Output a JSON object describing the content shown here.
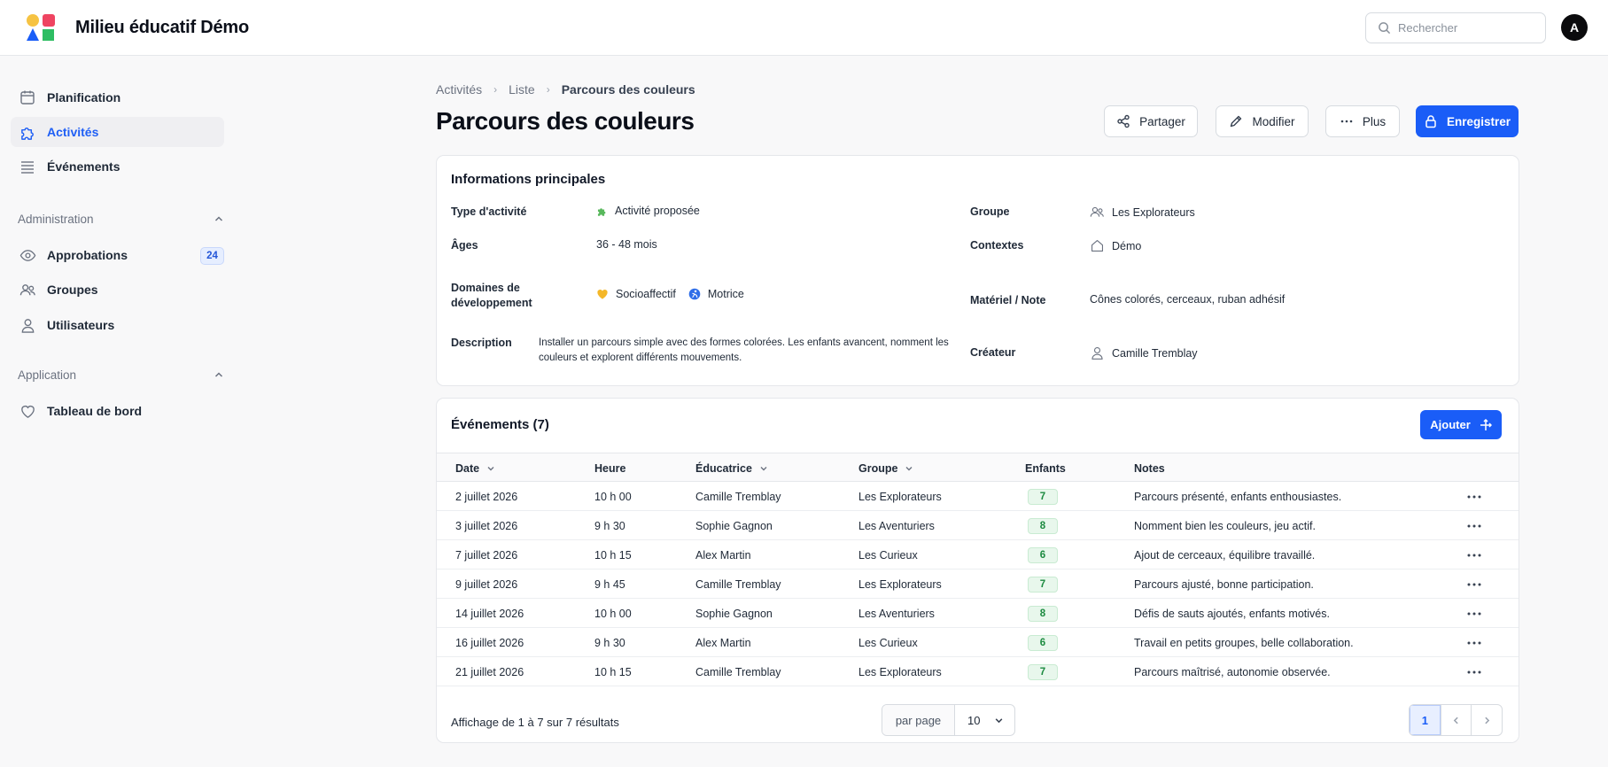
{
  "app": {
    "title": "Milieu éducatif Démo",
    "avatar_initial": "A"
  },
  "search": {
    "placeholder": "Rechercher",
    "value": ""
  },
  "sidebar": {
    "main_items": [
      {
        "label": "Planification",
        "icon": "calendar-icon"
      },
      {
        "label": "Activités",
        "icon": "puzzle-icon",
        "active": true
      },
      {
        "label": "Événements",
        "icon": "list-icon"
      }
    ],
    "administration": {
      "title": "Administration",
      "items": [
        {
          "label": "Approbations",
          "icon": "eye-icon",
          "badge": "24"
        },
        {
          "label": "Groupes",
          "icon": "users-icon"
        },
        {
          "label": "Utilisateurs",
          "icon": "user-icon"
        }
      ]
    },
    "application": {
      "title": "Application",
      "items": [
        {
          "label": "Tableau de bord",
          "icon": "heart-icon"
        }
      ]
    }
  },
  "breadcrumb": {
    "root": "Activités",
    "list": "Liste",
    "current": "Parcours des couleurs"
  },
  "page": {
    "title": "Parcours des couleurs"
  },
  "actions": {
    "share": "Partager",
    "edit": "Modifier",
    "more": "Plus",
    "save": "Enregistrer"
  },
  "info": {
    "title": "Informations principales",
    "type_label": "Type d'activité",
    "type_value": "Activité proposée",
    "ages_label": "Âges",
    "ages_value": "36 - 48 mois",
    "domains_label": "Domaines de développement",
    "domains": [
      "Socioaffectif",
      "Motrice"
    ],
    "description_label": "Description",
    "description": "Installer un parcours simple avec des formes colorées. Les enfants avancent, nomment les couleurs et explorent différents mouvements.",
    "group_label": "Groupe",
    "group_value": "Les Explorateurs",
    "contexts_label": "Contextes",
    "contexts_value": "Démo",
    "material_label": "Matériel / Note",
    "material_value": "Cônes colorés, cerceaux, ruban adhésif",
    "creator_label": "Créateur",
    "creator_value": "Camille Tremblay"
  },
  "events": {
    "title": "Événements (7)",
    "add_label": "Ajouter",
    "columns": {
      "date": "Date",
      "time": "Heure",
      "educator": "Éducatrice",
      "group": "Groupe",
      "kids": "Enfants",
      "notes": "Notes"
    },
    "rows": [
      {
        "date": "2 juillet 2026",
        "time": "10 h 00",
        "educator": "Camille Tremblay",
        "group": "Les Explorateurs",
        "kids": "7",
        "notes": "Parcours présenté, enfants enthousiastes."
      },
      {
        "date": "3 juillet 2026",
        "time": "9 h 30",
        "educator": "Sophie Gagnon",
        "group": "Les Aventuriers",
        "kids": "8",
        "notes": "Nomment bien les couleurs, jeu actif."
      },
      {
        "date": "7 juillet 2026",
        "time": "10 h 15",
        "educator": "Alex Martin",
        "group": "Les Curieux",
        "kids": "6",
        "notes": "Ajout de cerceaux, équilibre travaillé."
      },
      {
        "date": "9 juillet 2026",
        "time": "9 h 45",
        "educator": "Camille Tremblay",
        "group": "Les Explorateurs",
        "kids": "7",
        "notes": "Parcours ajusté, bonne participation."
      },
      {
        "date": "14 juillet 2026",
        "time": "10 h 00",
        "educator": "Sophie Gagnon",
        "group": "Les Aventuriers",
        "kids": "8",
        "notes": "Défis de sauts ajoutés, enfants motivés."
      },
      {
        "date": "16 juillet 2026",
        "time": "9 h 30",
        "educator": "Alex Martin",
        "group": "Les Curieux",
        "kids": "6",
        "notes": "Travail en petits groupes, belle collaboration."
      },
      {
        "date": "21 juillet 2026",
        "time": "10 h 15",
        "educator": "Camille Tremblay",
        "group": "Les Explorateurs",
        "kids": "7",
        "notes": "Parcours maîtrisé, autonomie observée."
      }
    ],
    "footer": "Affichage de 1 à 7 sur 7 résultats",
    "per_page_label": "par page",
    "per_page_value": "10",
    "current_page": "1"
  },
  "colors": {
    "accent": "#1a5df7",
    "active_nav_bg": "#efeff2",
    "badge_green": "#1b8a3f"
  }
}
